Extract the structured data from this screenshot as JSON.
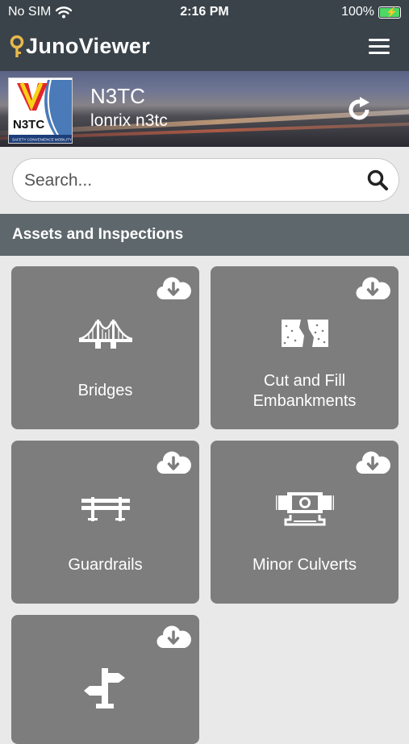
{
  "status_bar": {
    "carrier": "No SIM",
    "time": "2:16 PM",
    "battery": "100%"
  },
  "app": {
    "title": "JunoViewer"
  },
  "organization": {
    "name": "N3TC",
    "user": "lonrix n3tc",
    "logo_text": "N3TC",
    "logo_tagline": "SAFETY CONVENIENCE MOBILITY"
  },
  "search": {
    "placeholder": "Search..."
  },
  "section": {
    "title": "Assets and Inspections"
  },
  "tiles": [
    {
      "label": "Bridges",
      "icon": "bridge-icon"
    },
    {
      "label": "Cut and Fill Embankments",
      "icon": "embankment-icon"
    },
    {
      "label": "Guardrails",
      "icon": "guardrail-icon"
    },
    {
      "label": "Minor Culverts",
      "icon": "culvert-icon"
    },
    {
      "label": "",
      "icon": "signpost-icon"
    }
  ],
  "colors": {
    "appbar": "#3a434a",
    "section_header": "#5d676c",
    "tile": "#7d7d7d",
    "background": "#e9e9e9",
    "logo_key": "#e8b84a",
    "battery_fill": "#4cd964"
  }
}
